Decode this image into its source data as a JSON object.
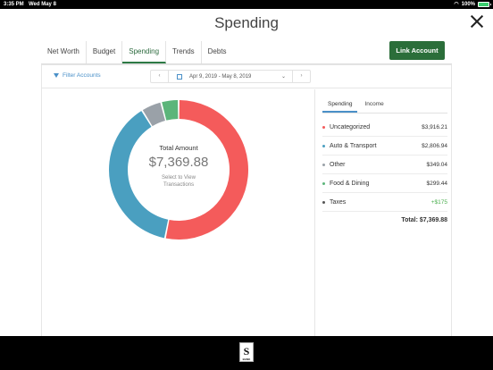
{
  "status": {
    "time": "3:35 PM",
    "date": "Wed May 8",
    "battery": "100%"
  },
  "page": {
    "title": "Spending"
  },
  "tabs": [
    {
      "label": "Net Worth"
    },
    {
      "label": "Budget"
    },
    {
      "label": "Spending",
      "active": true
    },
    {
      "label": "Trends"
    },
    {
      "label": "Debts"
    }
  ],
  "link_button": "Link Account",
  "filter": {
    "label": "Filter Accounts"
  },
  "date_range": {
    "label": "Apr 9, 2019 - May 8, 2019",
    "prev": "‹",
    "next": "›"
  },
  "center": {
    "label": "Total Amount",
    "amount": "$7,369.88",
    "sub_line1": "Select to View",
    "sub_line2": "Transactions"
  },
  "panel_tabs": [
    {
      "label": "Spending",
      "active": true
    },
    {
      "label": "Income"
    }
  ],
  "categories": [
    {
      "name": "Uncategorized",
      "amount": "$3,916.21",
      "color": "#f45b5b"
    },
    {
      "name": "Auto & Transport",
      "amount": "$2,806.94",
      "color": "#4a9fc0"
    },
    {
      "name": "Other",
      "amount": "$349.04",
      "color": "#9aa1a8"
    },
    {
      "name": "Food & Dining",
      "amount": "$299.44",
      "color": "#5cb57a"
    },
    {
      "name": "Taxes",
      "amount": "+$175",
      "color": "#555555",
      "positive": true
    }
  ],
  "total": "Total: $7,369.88",
  "chart_data": {
    "type": "pie",
    "categories": [
      "Uncategorized",
      "Auto & Transport",
      "Other",
      "Food & Dining"
    ],
    "values": [
      3916.21,
      2806.94,
      349.04,
      299.44
    ],
    "colors": [
      "#f45b5b",
      "#4a9fc0",
      "#9aa1a8",
      "#5cb57a"
    ]
  },
  "bank_logo": {
    "letter": "S",
    "caption": "BANK"
  }
}
